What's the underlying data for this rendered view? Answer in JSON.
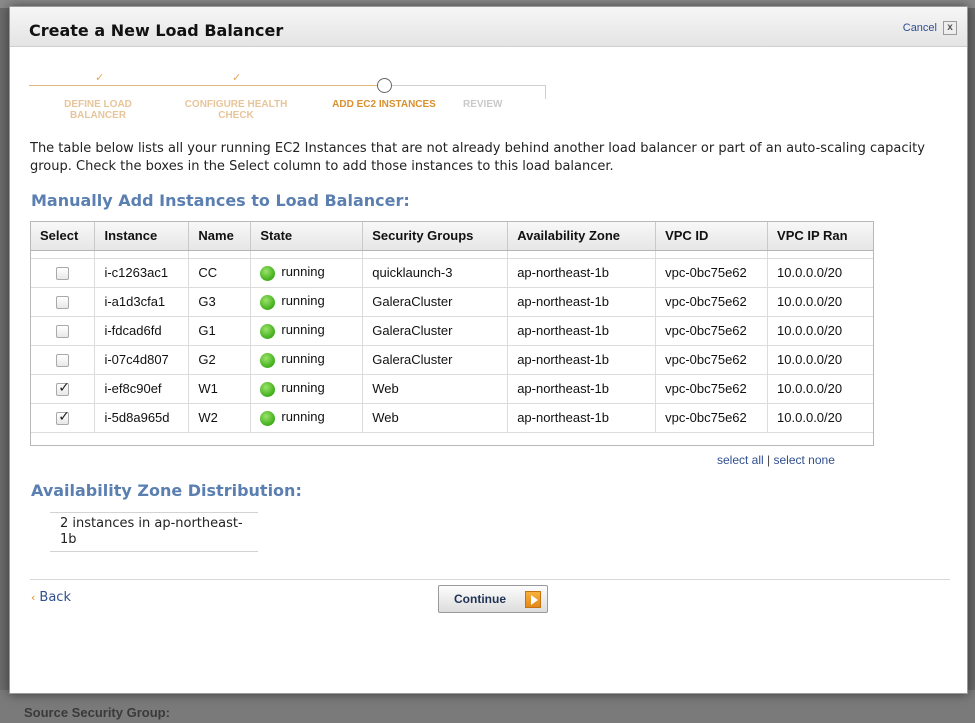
{
  "background": {
    "bottom_label": "Source Security Group:"
  },
  "modal": {
    "title": "Create a New Load Balancer",
    "cancel_label": "Cancel",
    "cancel_box": "x"
  },
  "wizard": {
    "steps": [
      {
        "label": "DEFINE LOAD BALANCER",
        "status": "done"
      },
      {
        "label": "CONFIGURE HEALTH CHECK",
        "status": "done"
      },
      {
        "label": "ADD EC2 INSTANCES",
        "status": "current"
      },
      {
        "label": "REVIEW",
        "status": "todo"
      }
    ]
  },
  "intro_text": "The table below lists all your running EC2 Instances that are not already behind another load balancer or part of an auto-scaling capacity group. Check the boxes in the Select column to add those instances to this load balancer.",
  "manual_section": {
    "title": "Manually Add Instances to Load Balancer:"
  },
  "table": {
    "headers": [
      "Select",
      "Instance",
      "Name",
      "State",
      "Security Groups",
      "Availability Zone",
      "VPC ID",
      "VPC IP Ran"
    ],
    "rows": [
      {
        "checked": false,
        "instance": "i-c1263ac1",
        "name": "CC",
        "state": "running",
        "security_group": "quicklaunch-3",
        "zone": "ap-northeast-1b",
        "vpc_id": "vpc-0bc75e62",
        "vpc_ip": "10.0.0.0/20"
      },
      {
        "checked": false,
        "instance": "i-a1d3cfa1",
        "name": "G3",
        "state": "running",
        "security_group": "GaleraCluster",
        "zone": "ap-northeast-1b",
        "vpc_id": "vpc-0bc75e62",
        "vpc_ip": "10.0.0.0/20"
      },
      {
        "checked": false,
        "instance": "i-fdcad6fd",
        "name": "G1",
        "state": "running",
        "security_group": "GaleraCluster",
        "zone": "ap-northeast-1b",
        "vpc_id": "vpc-0bc75e62",
        "vpc_ip": "10.0.0.0/20"
      },
      {
        "checked": false,
        "instance": "i-07c4d807",
        "name": "G2",
        "state": "running",
        "security_group": "GaleraCluster",
        "zone": "ap-northeast-1b",
        "vpc_id": "vpc-0bc75e62",
        "vpc_ip": "10.0.0.0/20"
      },
      {
        "checked": true,
        "instance": "i-ef8c90ef",
        "name": "W1",
        "state": "running",
        "security_group": "Web",
        "zone": "ap-northeast-1b",
        "vpc_id": "vpc-0bc75e62",
        "vpc_ip": "10.0.0.0/20"
      },
      {
        "checked": true,
        "instance": "i-5d8a965d",
        "name": "W2",
        "state": "running",
        "security_group": "Web",
        "zone": "ap-northeast-1b",
        "vpc_id": "vpc-0bc75e62",
        "vpc_ip": "10.0.0.0/20"
      }
    ]
  },
  "select_links": {
    "select_all": "select all",
    "separator": "|",
    "select_none": "select none"
  },
  "az_section": {
    "title": "Availability Zone Distribution:",
    "text": "2 instances in ap-northeast-1b"
  },
  "footer": {
    "back_chevron": "‹",
    "back_label": "Back",
    "continue_label": "Continue"
  },
  "colors": {
    "section_title": "#5a7fb0",
    "wizard_done": "#e7c59a",
    "wizard_current": "#d9902e",
    "running_dot": "#3fae1a",
    "continue_arrow": "#e4881a"
  }
}
